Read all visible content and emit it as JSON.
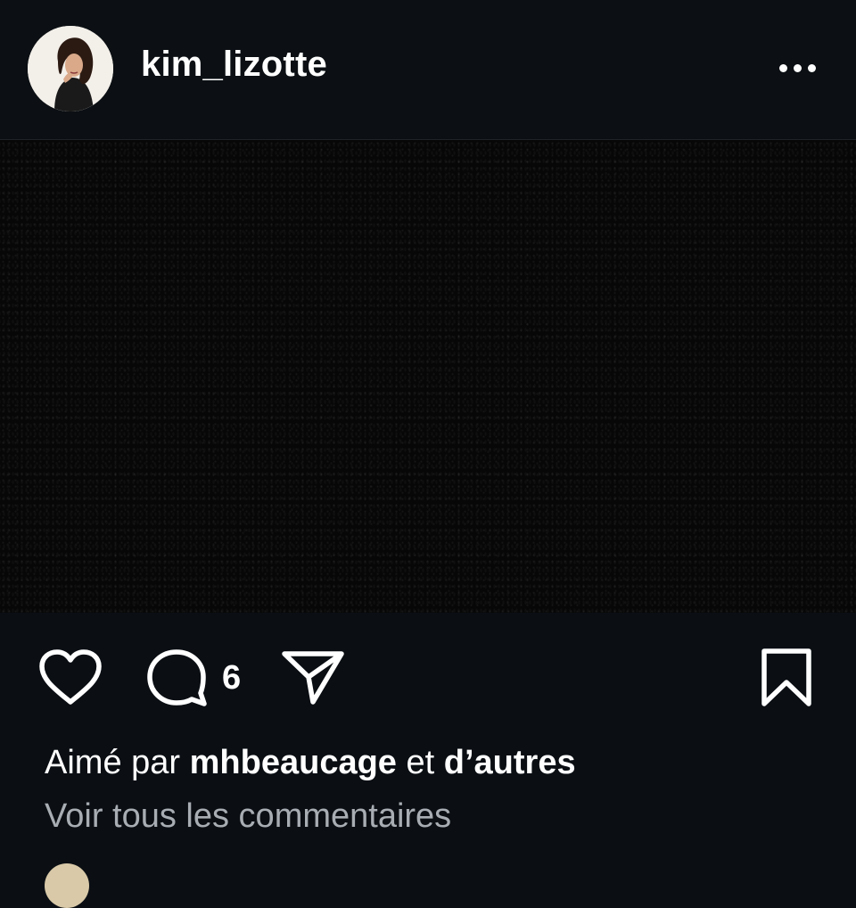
{
  "post": {
    "username": "kim_lizotte",
    "more_icon": "more-horizontal-icon",
    "comment_count": "6",
    "likes": {
      "prefix": "Aimé par",
      "user": "mhbeaucage",
      "connector": "et",
      "others": "d’autres"
    },
    "view_comments": "Voir tous les commentaires"
  },
  "icons": {
    "like": "heart-icon",
    "comment": "comment-bubble-icon",
    "share": "send-paper-plane-icon",
    "save": "bookmark-icon"
  },
  "colors": {
    "background": "#0c1014",
    "text": "#ffffff",
    "muted_text": "#a8adb3"
  }
}
